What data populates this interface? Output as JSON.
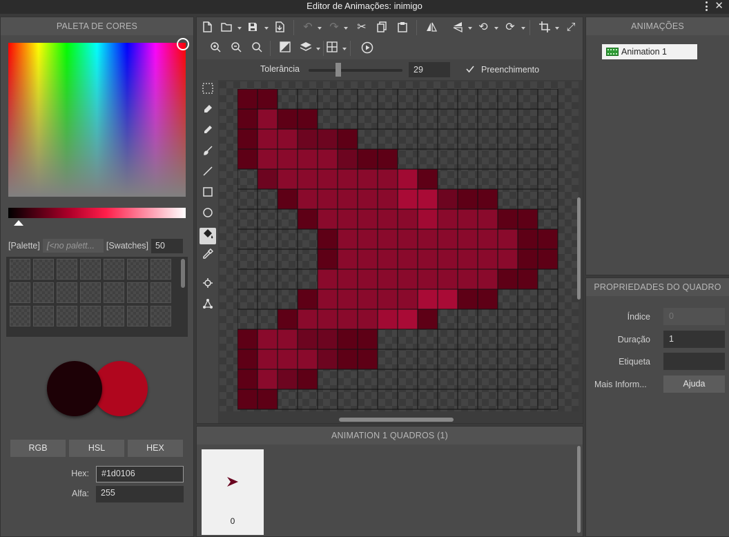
{
  "window": {
    "title": "Editor de Animações: inimigo"
  },
  "left": {
    "header": "PALETA DE CORES",
    "palette_label": "[Palette]",
    "palette_value": "[<no palett...",
    "swatches_label": "[Swatches]",
    "swatches_count": "50",
    "modes": [
      "RGB",
      "HSL",
      "HEX"
    ],
    "hex_label": "Hex:",
    "hex_value": "#1d0106",
    "alpha_label": "Alfa:",
    "alpha_value": "255",
    "primary_color": "#1d0106",
    "secondary_color": "#b0061e"
  },
  "toolbar": {
    "icons": [
      "new-file-icon",
      "open-folder-icon",
      "save-icon",
      "export-icon",
      "undo-icon",
      "redo-icon",
      "cut-icon",
      "copy-icon",
      "paste-icon",
      "flip-horizontal-icon",
      "flip-vertical-icon",
      "rotate-left-icon",
      "rotate-right-icon",
      "crop-icon",
      "expand-icon",
      "zoom-in-icon",
      "zoom-out-icon",
      "zoom-reset-icon",
      "onion-skin-icon",
      "layers-icon",
      "grid-icon",
      "play-icon"
    ]
  },
  "options": {
    "tolerance_label": "Tolerância",
    "tolerance_value": "29",
    "fill_label": "Preenchimento",
    "fill_checked": true
  },
  "tools": [
    "select-tool",
    "eraser-tool",
    "pencil-tool",
    "brush-tool",
    "line-tool",
    "rectangle-tool",
    "ellipse-tool",
    "fill-tool",
    "eyedropper-tool",
    "origin-tool",
    "skeleton-tool"
  ],
  "sprite": {
    "palette": {
      "0": "transparent",
      "1": "#5e0016",
      "2": "#8a0a2c",
      "3": "#6d0520",
      "4": "#a10a33",
      "5": "#98082e",
      "6": "#a90b36",
      "7": "#7a0624"
    },
    "rows": [
      "1100000000000000",
      "1211000000000000",
      "1223310000000000",
      "1222231100000000",
      "0322222241000000",
      "0012222266311000",
      "0001222224222110",
      "0000122222222211",
      "0000122222222211",
      "0000222222222110",
      "0001222226611000",
      "0012222461000000",
      "1223311000000000",
      "1222311000000000",
      "1231000000000000",
      "1100000000000000"
    ]
  },
  "frames": {
    "header": "ANIMATION 1 QUADROS (1)",
    "items": [
      {
        "index": "0"
      }
    ]
  },
  "animations": {
    "header": "ANIMAÇÕES",
    "items": [
      {
        "name": "Animation 1"
      }
    ]
  },
  "properties": {
    "header": "PROPRIEDADES DO QUADRO",
    "index_label": "Índice",
    "index_value": "0",
    "duration_label": "Duração",
    "duration_value": "1",
    "tag_label": "Etiqueta",
    "tag_value": "",
    "more_label": "Mais Inform...",
    "help_button": "Ajuda"
  }
}
